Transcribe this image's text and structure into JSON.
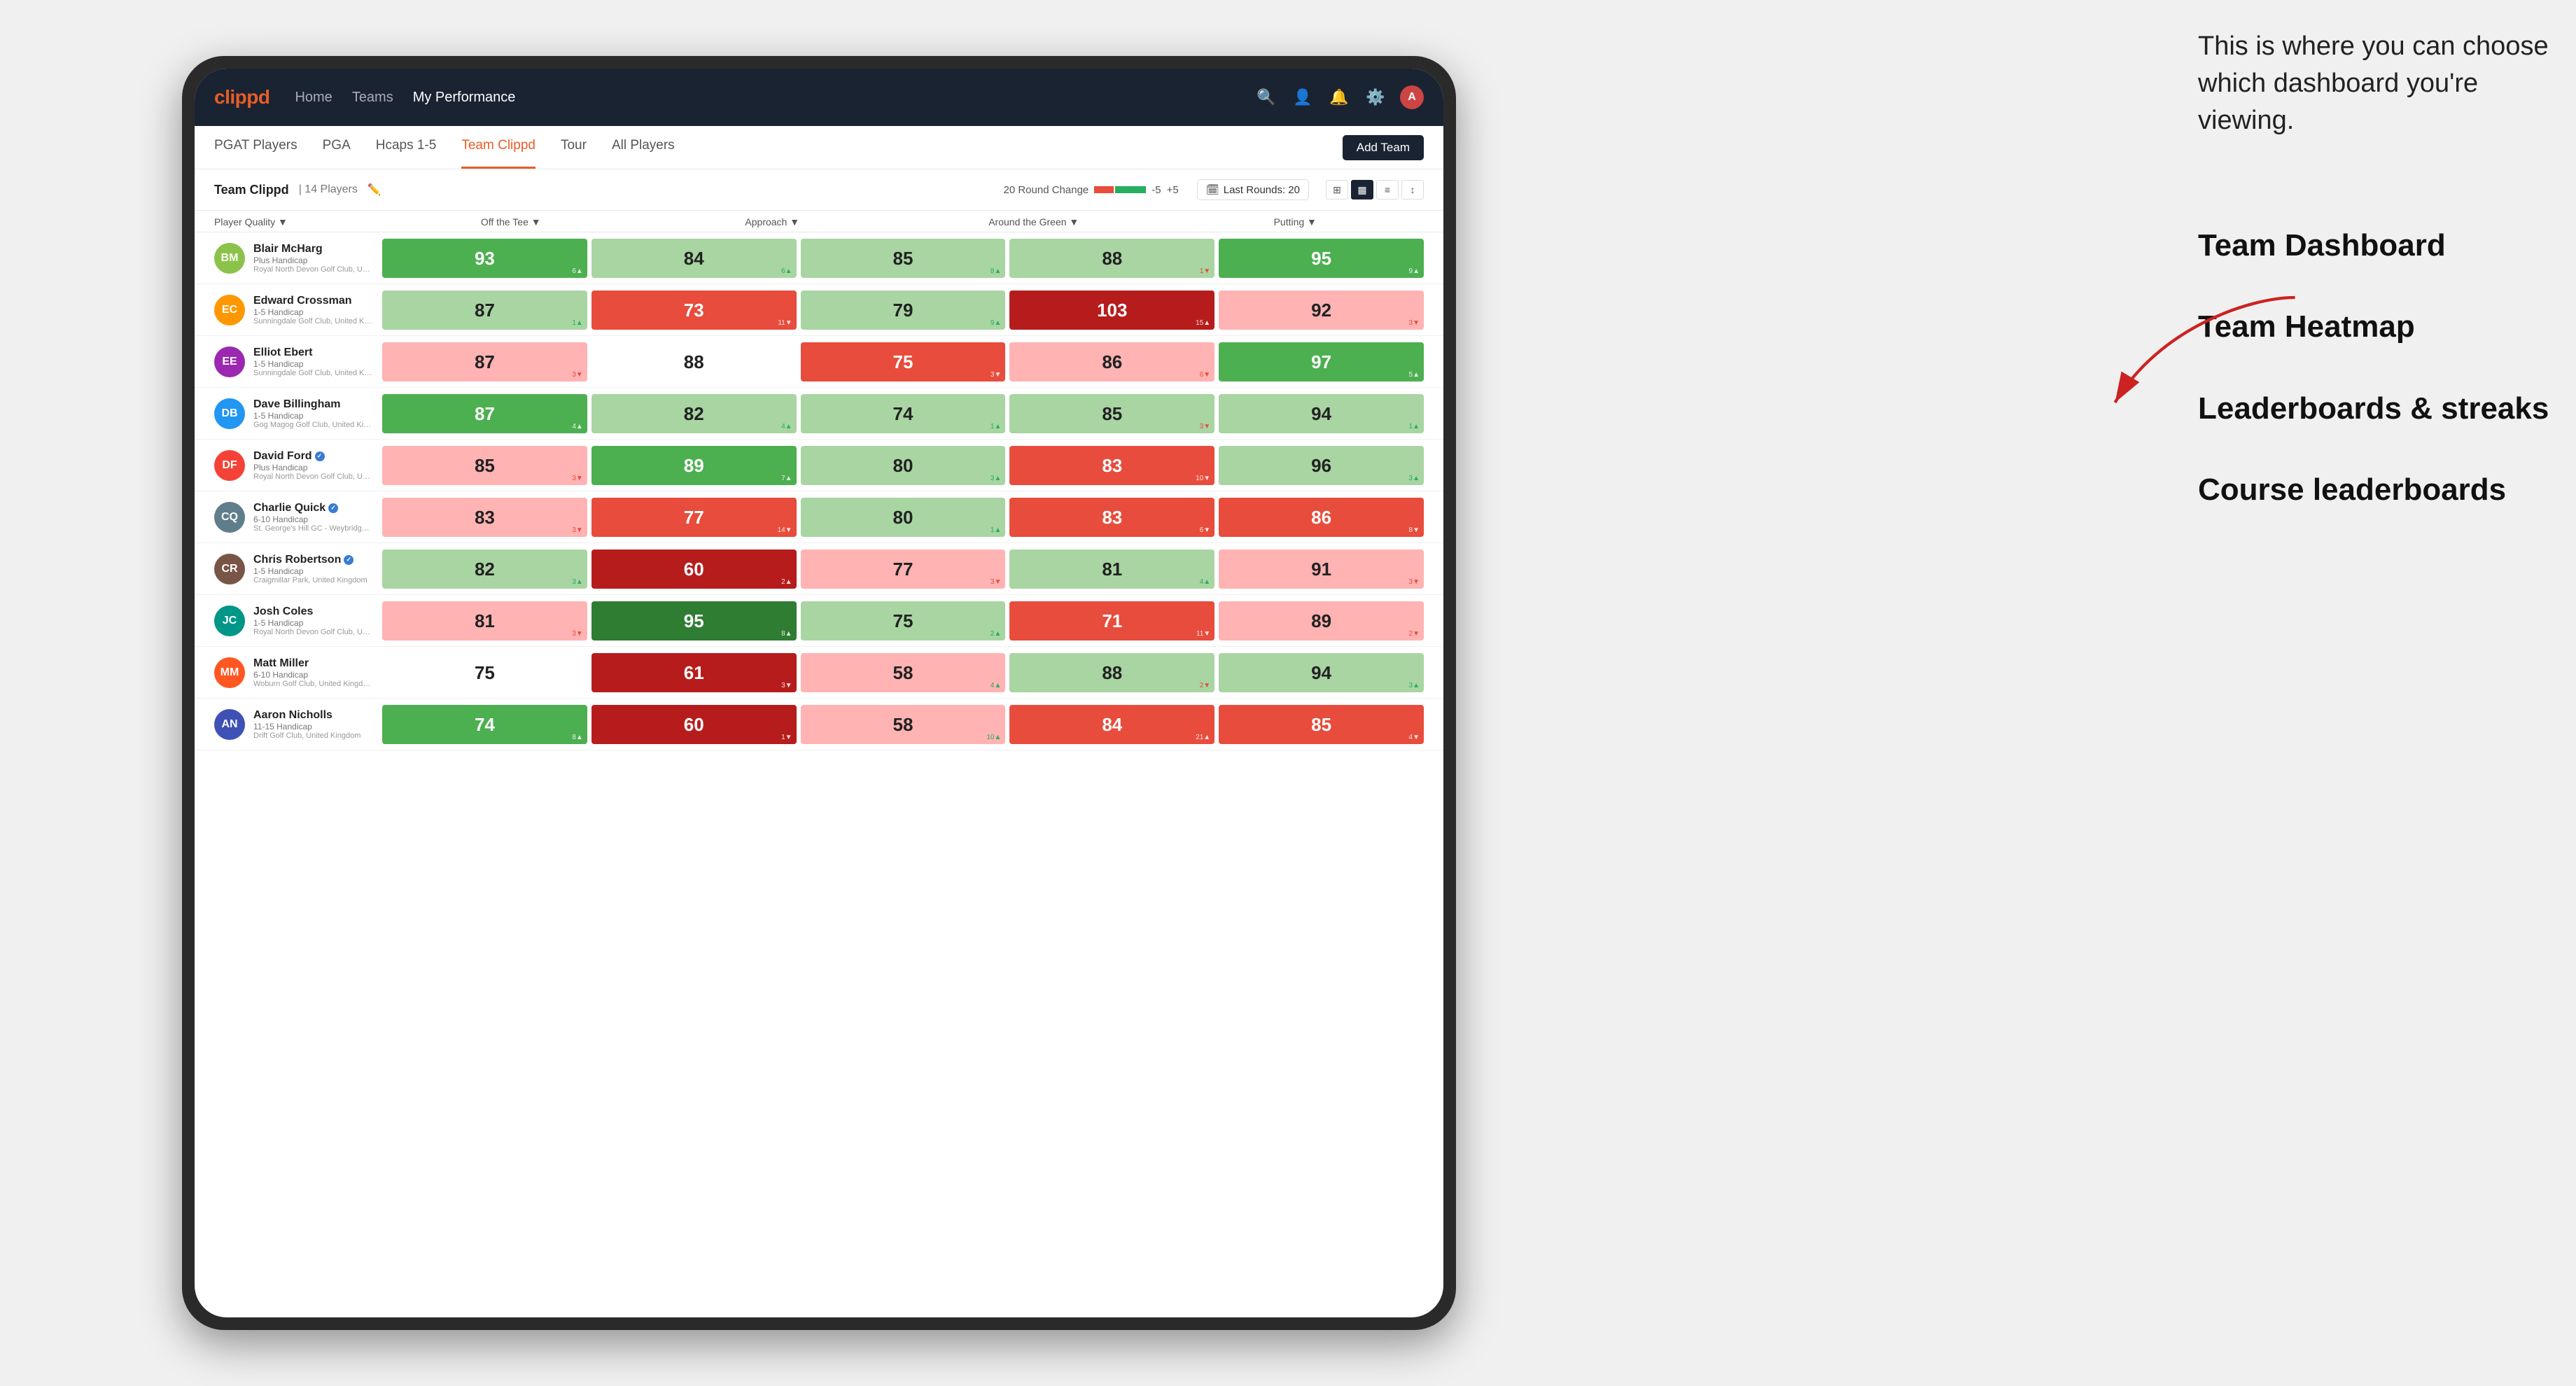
{
  "annotation": {
    "intro": "This is where you can choose which dashboard you're viewing.",
    "items": [
      {
        "label": "Team Dashboard"
      },
      {
        "label": "Team Heatmap"
      },
      {
        "label": "Leaderboards & streaks"
      },
      {
        "label": "Course leaderboards"
      }
    ]
  },
  "nav": {
    "logo": "clippd",
    "items": [
      {
        "label": "Home",
        "active": false
      },
      {
        "label": "Teams",
        "active": false
      },
      {
        "label": "My Performance",
        "active": true
      }
    ]
  },
  "tabs": {
    "items": [
      {
        "label": "PGAT Players",
        "active": false
      },
      {
        "label": "PGA",
        "active": false
      },
      {
        "label": "Hcaps 1-5",
        "active": false
      },
      {
        "label": "Team Clippd",
        "active": true
      },
      {
        "label": "Tour",
        "active": false
      },
      {
        "label": "All Players",
        "active": false
      }
    ],
    "add_team": "Add Team"
  },
  "team": {
    "name": "Team Clippd",
    "separator": "|",
    "count": "14 Players",
    "round_change_label": "20 Round Change",
    "change_minus": "-5",
    "change_plus": "+5",
    "last_rounds_icon": "🗓",
    "last_rounds_label": "Last Rounds:",
    "last_rounds_value": "20"
  },
  "columns": {
    "player": "Player Quality ▼",
    "stats": [
      {
        "label": "Off the Tee",
        "arrow": "▼"
      },
      {
        "label": "Approach",
        "arrow": "▼"
      },
      {
        "label": "Around the Green",
        "arrow": "▼"
      },
      {
        "label": "Putting",
        "arrow": "▼"
      }
    ]
  },
  "players": [
    {
      "name": "Blair McHarg",
      "handicap": "Plus Handicap",
      "club": "Royal North Devon Golf Club, United Kingdom",
      "avatar_color": "av1",
      "initials": "BM",
      "verified": false,
      "stats": [
        {
          "value": "93",
          "change": "6▲",
          "color": "cell-green"
        },
        {
          "value": "84",
          "change": "6▲",
          "color": "cell-light-green"
        },
        {
          "value": "85",
          "change": "8▲",
          "color": "cell-light-green"
        },
        {
          "value": "88",
          "change": "1▼",
          "color": "cell-light-green"
        },
        {
          "value": "95",
          "change": "9▲",
          "color": "cell-green"
        }
      ]
    },
    {
      "name": "Edward Crossman",
      "handicap": "1-5 Handicap",
      "club": "Sunningdale Golf Club, United Kingdom",
      "avatar_color": "av2",
      "initials": "EC",
      "verified": false,
      "stats": [
        {
          "value": "87",
          "change": "1▲",
          "color": "cell-light-green"
        },
        {
          "value": "73",
          "change": "11▼",
          "color": "cell-red"
        },
        {
          "value": "79",
          "change": "9▲",
          "color": "cell-light-green"
        },
        {
          "value": "103",
          "change": "15▲",
          "color": "cell-dark-red"
        },
        {
          "value": "92",
          "change": "3▼",
          "color": "cell-light-red"
        }
      ]
    },
    {
      "name": "Elliot Ebert",
      "handicap": "1-5 Handicap",
      "club": "Sunningdale Golf Club, United Kingdom",
      "avatar_color": "av3",
      "initials": "EE",
      "verified": false,
      "stats": [
        {
          "value": "87",
          "change": "3▼",
          "color": "cell-light-red"
        },
        {
          "value": "88",
          "change": "",
          "color": "cell-white"
        },
        {
          "value": "75",
          "change": "3▼",
          "color": "cell-red"
        },
        {
          "value": "86",
          "change": "6▼",
          "color": "cell-light-red"
        },
        {
          "value": "97",
          "change": "5▲",
          "color": "cell-green"
        }
      ]
    },
    {
      "name": "Dave Billingham",
      "handicap": "1-5 Handicap",
      "club": "Gog Magog Golf Club, United Kingdom",
      "avatar_color": "av4",
      "initials": "DB",
      "verified": false,
      "stats": [
        {
          "value": "87",
          "change": "4▲",
          "color": "cell-green"
        },
        {
          "value": "82",
          "change": "4▲",
          "color": "cell-light-green"
        },
        {
          "value": "74",
          "change": "1▲",
          "color": "cell-light-green"
        },
        {
          "value": "85",
          "change": "3▼",
          "color": "cell-light-green"
        },
        {
          "value": "94",
          "change": "1▲",
          "color": "cell-light-green"
        }
      ]
    },
    {
      "name": "David Ford",
      "handicap": "Plus Handicap",
      "club": "Royal North Devon Golf Club, United Kingdom",
      "avatar_color": "av5",
      "initials": "DF",
      "verified": true,
      "stats": [
        {
          "value": "85",
          "change": "3▼",
          "color": "cell-light-red"
        },
        {
          "value": "89",
          "change": "7▲",
          "color": "cell-green"
        },
        {
          "value": "80",
          "change": "3▲",
          "color": "cell-light-green"
        },
        {
          "value": "83",
          "change": "10▼",
          "color": "cell-red"
        },
        {
          "value": "96",
          "change": "3▲",
          "color": "cell-light-green"
        }
      ]
    },
    {
      "name": "Charlie Quick",
      "handicap": "6-10 Handicap",
      "club": "St. George's Hill GC - Weybridge - Surrey, Uni...",
      "avatar_color": "av6",
      "initials": "CQ",
      "verified": true,
      "stats": [
        {
          "value": "83",
          "change": "3▼",
          "color": "cell-light-red"
        },
        {
          "value": "77",
          "change": "14▼",
          "color": "cell-red"
        },
        {
          "value": "80",
          "change": "1▲",
          "color": "cell-light-green"
        },
        {
          "value": "83",
          "change": "6▼",
          "color": "cell-red"
        },
        {
          "value": "86",
          "change": "8▼",
          "color": "cell-red"
        }
      ]
    },
    {
      "name": "Chris Robertson",
      "handicap": "1-5 Handicap",
      "club": "Craigmillar Park, United Kingdom",
      "avatar_color": "av7",
      "initials": "CR",
      "verified": true,
      "stats": [
        {
          "value": "82",
          "change": "3▲",
          "color": "cell-light-green"
        },
        {
          "value": "60",
          "change": "2▲",
          "color": "cell-dark-red"
        },
        {
          "value": "77",
          "change": "3▼",
          "color": "cell-light-red"
        },
        {
          "value": "81",
          "change": "4▲",
          "color": "cell-light-green"
        },
        {
          "value": "91",
          "change": "3▼",
          "color": "cell-light-red"
        }
      ]
    },
    {
      "name": "Josh Coles",
      "handicap": "1-5 Handicap",
      "club": "Royal North Devon Golf Club, United Kingdom",
      "avatar_color": "av8",
      "initials": "JC",
      "verified": false,
      "stats": [
        {
          "value": "81",
          "change": "3▼",
          "color": "cell-light-red"
        },
        {
          "value": "95",
          "change": "8▲",
          "color": "cell-dark-green"
        },
        {
          "value": "75",
          "change": "2▲",
          "color": "cell-light-green"
        },
        {
          "value": "71",
          "change": "11▼",
          "color": "cell-red"
        },
        {
          "value": "89",
          "change": "2▼",
          "color": "cell-light-red"
        }
      ]
    },
    {
      "name": "Matt Miller",
      "handicap": "6-10 Handicap",
      "club": "Woburn Golf Club, United Kingdom",
      "avatar_color": "av9",
      "initials": "MM",
      "verified": false,
      "stats": [
        {
          "value": "75",
          "change": "",
          "color": "cell-white"
        },
        {
          "value": "61",
          "change": "3▼",
          "color": "cell-dark-red"
        },
        {
          "value": "58",
          "change": "4▲",
          "color": "cell-light-red"
        },
        {
          "value": "88",
          "change": "2▼",
          "color": "cell-light-green"
        },
        {
          "value": "94",
          "change": "3▲",
          "color": "cell-light-green"
        }
      ]
    },
    {
      "name": "Aaron Nicholls",
      "handicap": "11-15 Handicap",
      "club": "Drift Golf Club, United Kingdom",
      "avatar_color": "av10",
      "initials": "AN",
      "verified": false,
      "stats": [
        {
          "value": "74",
          "change": "8▲",
          "color": "cell-green"
        },
        {
          "value": "60",
          "change": "1▼",
          "color": "cell-dark-red"
        },
        {
          "value": "58",
          "change": "10▲",
          "color": "cell-light-red"
        },
        {
          "value": "84",
          "change": "21▲",
          "color": "cell-red"
        },
        {
          "value": "85",
          "change": "4▼",
          "color": "cell-red"
        }
      ]
    }
  ]
}
